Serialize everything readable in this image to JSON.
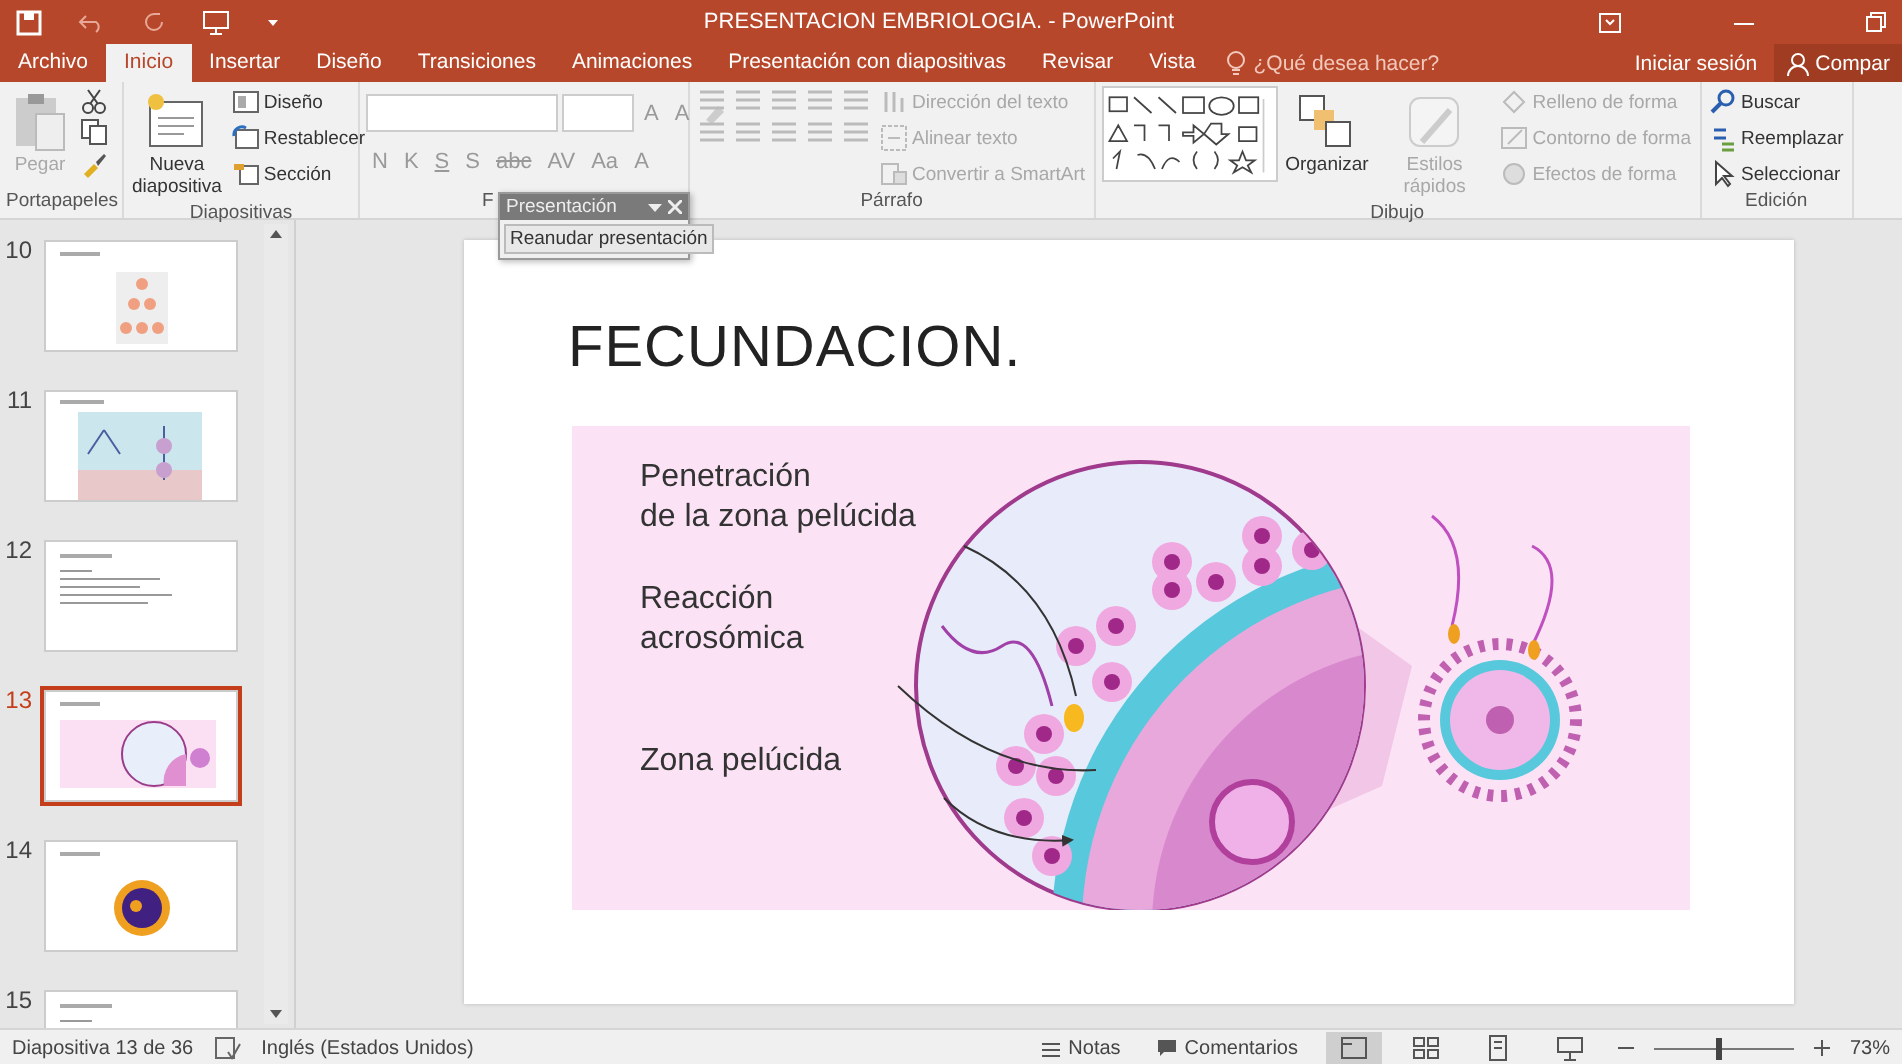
{
  "window": {
    "title": "PRESENTACION EMBRIOLOGIA. - PowerPoint"
  },
  "tabs": [
    {
      "label": "Archivo",
      "selected": false
    },
    {
      "label": "Inicio",
      "selected": true
    },
    {
      "label": "Insertar",
      "selected": false
    },
    {
      "label": "Diseño",
      "selected": false
    },
    {
      "label": "Transiciones",
      "selected": false
    },
    {
      "label": "Animaciones",
      "selected": false
    },
    {
      "label": "Presentación con diapositivas",
      "selected": false
    },
    {
      "label": "Revisar",
      "selected": false
    },
    {
      "label": "Vista",
      "selected": false
    }
  ],
  "tell_me": {
    "placeholder": "¿Qué desea hacer?"
  },
  "account": {
    "sign_in": "Iniciar sesión",
    "share": "Compar"
  },
  "ribbon": [
    {
      "label": "Portapapeles",
      "columns": [
        [
          {
            "kind": "large",
            "label": "Pegar",
            "disabled": true
          }
        ],
        [
          {
            "kind": "icon"
          },
          {
            "kind": "icon"
          },
          {
            "kind": "icon"
          }
        ]
      ]
    },
    {
      "label": "Diapositivas",
      "columns": [
        [
          {
            "kind": "large",
            "label": "Nueva diapositiva",
            "disabled": false
          }
        ],
        [
          {
            "kind": "small",
            "label": "Diseño",
            "disabled": false
          },
          {
            "kind": "small",
            "label": "Restablecer",
            "disabled": false
          },
          {
            "kind": "small",
            "label": "Sección",
            "disabled": false
          }
        ]
      ]
    },
    {
      "label": "F",
      "columns": [
        [
          {
            "kind": "fonts",
            "glyphs": [
              "A",
              "A"
            ]
          },
          {
            "kind": "glyphs",
            "glyphs": [
              "N",
              "K",
              "S",
              "S",
              "abc",
              "AV",
              "Aa",
              "A"
            ]
          }
        ]
      ]
    },
    {
      "label": "Párrafo",
      "columns": [
        [
          {
            "kind": "icons"
          },
          {
            "kind": "icons"
          }
        ],
        [
          {
            "kind": "small",
            "label": "Dirección del texto",
            "disabled": true
          },
          {
            "kind": "small",
            "label": "Alinear texto",
            "disabled": true
          },
          {
            "kind": "small",
            "label": "Convertir a SmartArt",
            "disabled": true
          }
        ]
      ]
    },
    {
      "label": "Dibujo",
      "columns": [
        [
          {
            "kind": "gallery"
          }
        ],
        [
          {
            "kind": "large",
            "label": "Organizar",
            "disabled": false
          }
        ],
        [
          {
            "kind": "large",
            "label": "Estilos rápidos",
            "disabled": true
          }
        ],
        [
          {
            "kind": "small",
            "label": "Relleno de forma",
            "disabled": true
          },
          {
            "kind": "small",
            "label": "Contorno de forma",
            "disabled": true
          },
          {
            "kind": "small",
            "label": "Efectos de forma",
            "disabled": true
          }
        ]
      ]
    },
    {
      "label": "Edición",
      "columns": [
        [
          {
            "kind": "small",
            "label": "Buscar",
            "disabled": false
          },
          {
            "kind": "small",
            "label": "Reemplazar",
            "disabled": false
          },
          {
            "kind": "small",
            "label": "Seleccionar",
            "disabled": false
          }
        ]
      ]
    }
  ],
  "presentation_popup": {
    "title": "Presentación",
    "button": "Reanudar presentación"
  },
  "thumbnails": [
    {
      "number": "10",
      "kind": "chart",
      "selected": false
    },
    {
      "number": "11",
      "kind": "diagram",
      "selected": false
    },
    {
      "number": "12",
      "kind": "text",
      "selected": false
    },
    {
      "number": "13",
      "kind": "fecundation",
      "selected": true
    },
    {
      "number": "14",
      "kind": "cell",
      "selected": false
    },
    {
      "number": "15",
      "kind": "text",
      "selected": false
    }
  ],
  "slide": {
    "title": "FECUNDACION.",
    "labels": [
      "Penetración\nde la zona pelúcida",
      "Reacción\nacrosómica",
      "Zona pelúcida"
    ]
  },
  "status_bar": {
    "slide": "Diapositiva 13 de 36",
    "language": "Inglés (Estados Unidos)",
    "notes": "Notas",
    "comments": "Comentarios",
    "views": [
      {
        "selected": true
      },
      {
        "selected": false
      },
      {
        "selected": false
      },
      {
        "selected": false
      }
    ],
    "zoom": {
      "level": 0.45,
      "reading": "73%"
    }
  }
}
